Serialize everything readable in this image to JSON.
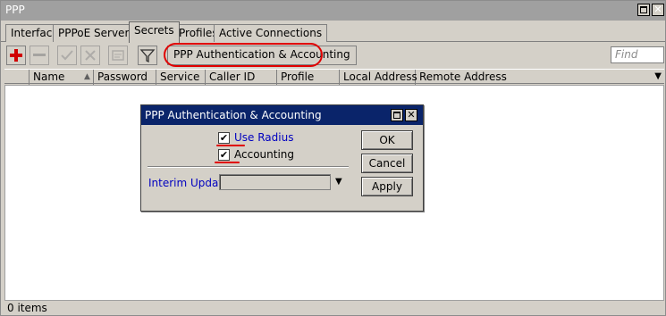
{
  "window": {
    "title": "PPP"
  },
  "tabs": [
    {
      "label": "Interface"
    },
    {
      "label": "PPPoE Servers"
    },
    {
      "label": "Secrets"
    },
    {
      "label": "Profiles"
    },
    {
      "label": "Active Connections"
    }
  ],
  "toolbar": {
    "add_icon": "plus-icon",
    "remove_icon": "minus-icon",
    "enable_icon": "check-icon",
    "disable_icon": "x-icon",
    "comment_icon": "note-icon",
    "filter_icon": "filter-icon",
    "auth_button_label": "PPP Authentication & Accounting",
    "find_placeholder": "Find"
  },
  "columns": [
    "Name",
    "Password",
    "Service",
    "Caller ID",
    "Profile",
    "Local Address",
    "Remote Address"
  ],
  "status": {
    "count_text": "0 items"
  },
  "dialog": {
    "title": "PPP Authentication & Accounting",
    "use_radius_label": "Use Radius",
    "use_radius_checked": true,
    "accounting_label": "Accounting",
    "accounting_checked": true,
    "interim_update_label": "Interim Update:",
    "interim_update_value": "",
    "ok_label": "OK",
    "cancel_label": "Cancel",
    "apply_label": "Apply"
  },
  "colors": {
    "annotation": "#e00000",
    "dialog_title": "#0a246a",
    "link_blue": "#0000c0"
  }
}
